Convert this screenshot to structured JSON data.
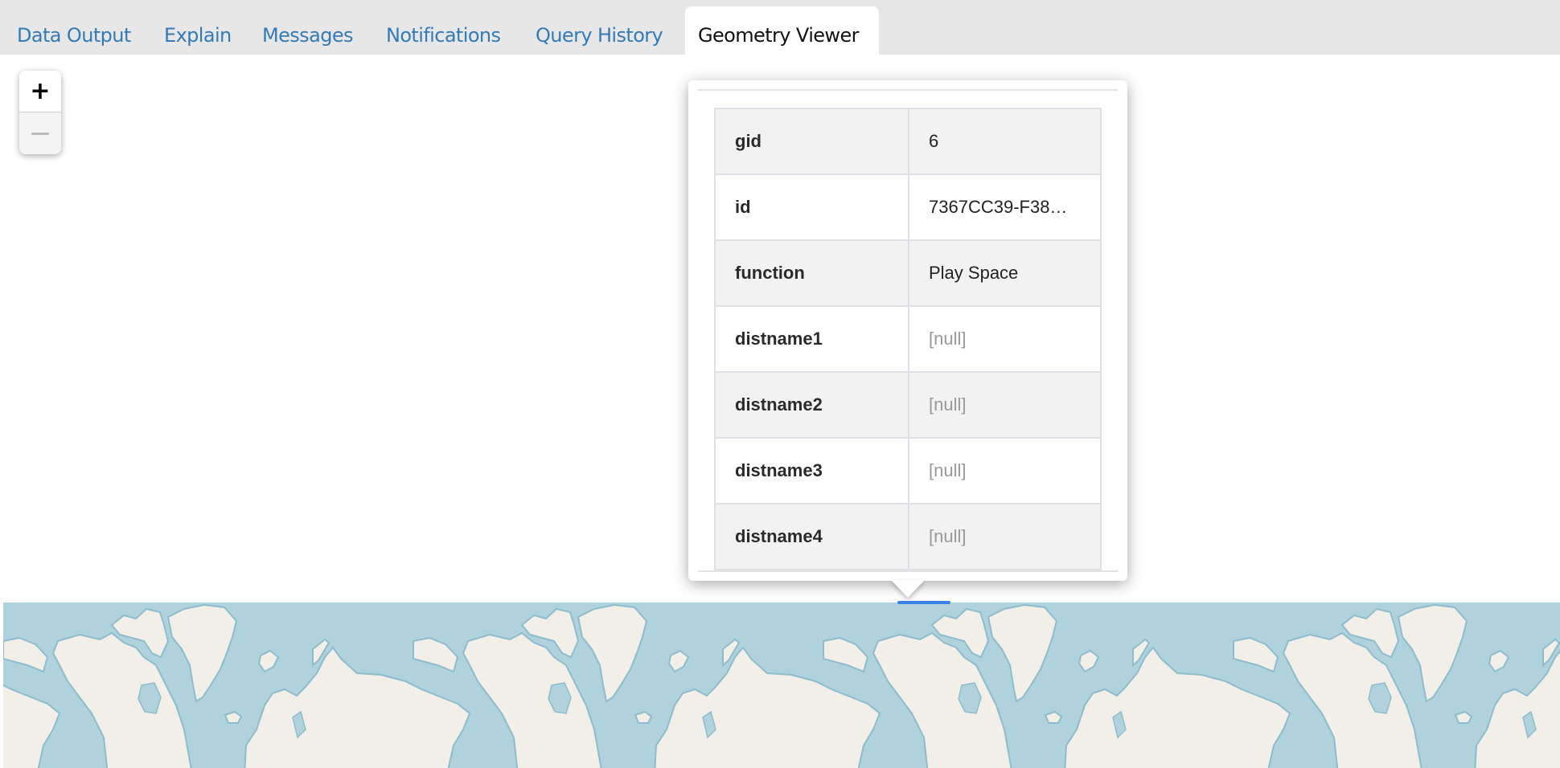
{
  "tabs": [
    {
      "label": "Data Output",
      "active": false
    },
    {
      "label": "Explain",
      "active": false
    },
    {
      "label": "Messages",
      "active": false
    },
    {
      "label": "Notifications",
      "active": false
    },
    {
      "label": "Query History",
      "active": false
    },
    {
      "label": "Geometry Viewer",
      "active": true
    }
  ],
  "map": {
    "zoom_in_label": "+",
    "zoom_out_label": "−",
    "zoom_out_disabled": true,
    "water_color": "#b0d2dc",
    "land_color": "#f2efe9",
    "coast_color": "#8dbccd",
    "selected_geometry_color": "#3b82e6"
  },
  "popup": {
    "rows": [
      {
        "key": "gid",
        "value": "6",
        "is_null": false
      },
      {
        "key": "id",
        "value": "7367CC39-F38…",
        "is_null": false
      },
      {
        "key": "function",
        "value": "Play Space",
        "is_null": false
      },
      {
        "key": "distname1",
        "value": "[null]",
        "is_null": true
      },
      {
        "key": "distname2",
        "value": "[null]",
        "is_null": true
      },
      {
        "key": "distname3",
        "value": "[null]",
        "is_null": true
      },
      {
        "key": "distname4",
        "value": "[null]",
        "is_null": true
      },
      {
        "key": "",
        "value": "",
        "is_null": false
      }
    ]
  }
}
